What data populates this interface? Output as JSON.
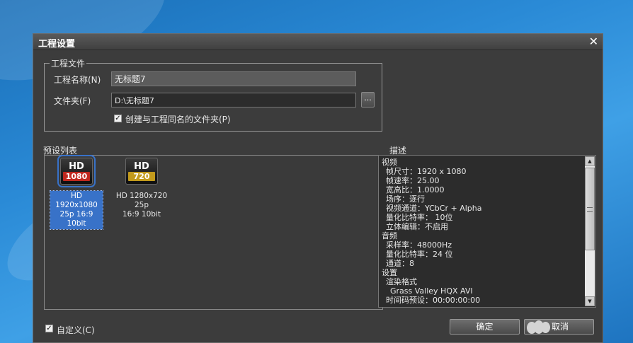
{
  "dialog": {
    "title": "工程设置",
    "close_glyph": "✕"
  },
  "project_file": {
    "legend": "工程文件",
    "name_label": "工程名称(N)",
    "name_value": "无标题7",
    "folder_label": "文件夹(F)",
    "folder_value": "D:\\无标题7",
    "browse_label": "...",
    "create_folder_checked": true,
    "create_folder_label": "创建与工程同名的文件夹(P)"
  },
  "preset_list": {
    "label": "预设列表",
    "presets": [
      {
        "badge": "HD",
        "res": "1080",
        "badge_color": "#c0281e",
        "line1": "HD 1920x1080",
        "line2": "25p 16:9 10bit",
        "selected": true
      },
      {
        "badge": "HD",
        "res": "720",
        "badge_color": "#c29a1c",
        "line1": "HD 1280x720 25p",
        "line2": "16:9 10bit",
        "selected": false
      }
    ]
  },
  "description": {
    "label": "描述",
    "lines": [
      {
        "text": "视频",
        "indent": 0
      },
      {
        "text": "帧尺寸：1920 x 1080",
        "indent": 1
      },
      {
        "text": "帧速率：25.00",
        "indent": 1
      },
      {
        "text": "宽高比：1.0000",
        "indent": 1
      },
      {
        "text": "场序：逐行",
        "indent": 1
      },
      {
        "text": "视频通道：YCbCr + Alpha",
        "indent": 1
      },
      {
        "text": "量化比特率： 10位",
        "indent": 1
      },
      {
        "text": "立体编辑：不启用",
        "indent": 1
      },
      {
        "text": "音频",
        "indent": 0
      },
      {
        "text": "采样率：48000Hz",
        "indent": 1
      },
      {
        "text": "量化比特率：24 位",
        "indent": 1
      },
      {
        "text": "通道：8",
        "indent": 1
      },
      {
        "text": "设置",
        "indent": 0
      },
      {
        "text": "渲染格式",
        "indent": 1
      },
      {
        "text": "Grass Valley HQX AVI",
        "indent": 2
      },
      {
        "text": "时间码预设：00:00:00:00",
        "indent": 1
      }
    ]
  },
  "footer": {
    "custom_checked": true,
    "custom_label": "自定义(C)",
    "ok_label": "确定",
    "cancel_label": "取消"
  }
}
